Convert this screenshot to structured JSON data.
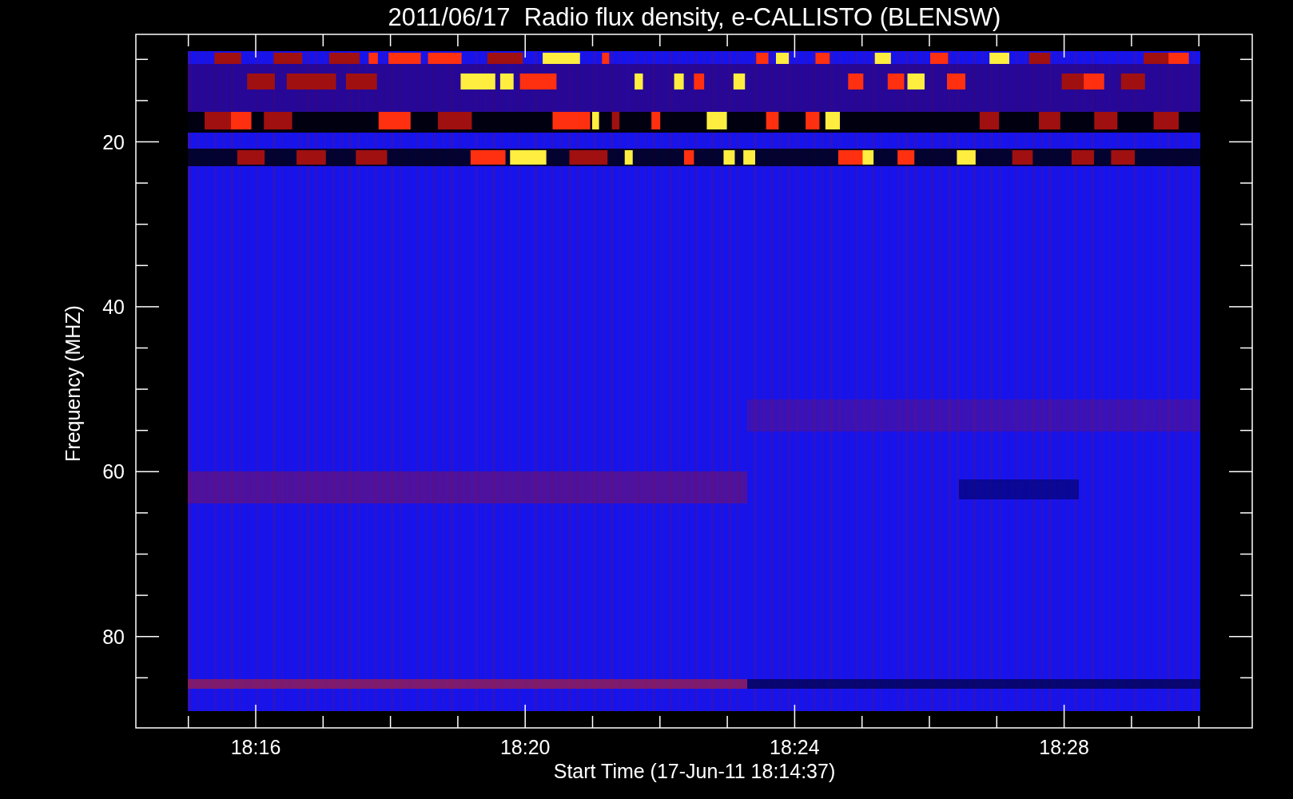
{
  "title": "2011/06/17  Radio flux density, e-CALLISTO (BLENSW)",
  "y_axis": {
    "label": "Frequency (MHZ)",
    "ticks": [
      "20",
      "40",
      "60",
      "80"
    ]
  },
  "x_axis": {
    "label": "Start Time (17-Jun-11 18:14:37)",
    "ticks": [
      "18:16",
      "18:20",
      "18:24",
      "18:28"
    ]
  }
}
